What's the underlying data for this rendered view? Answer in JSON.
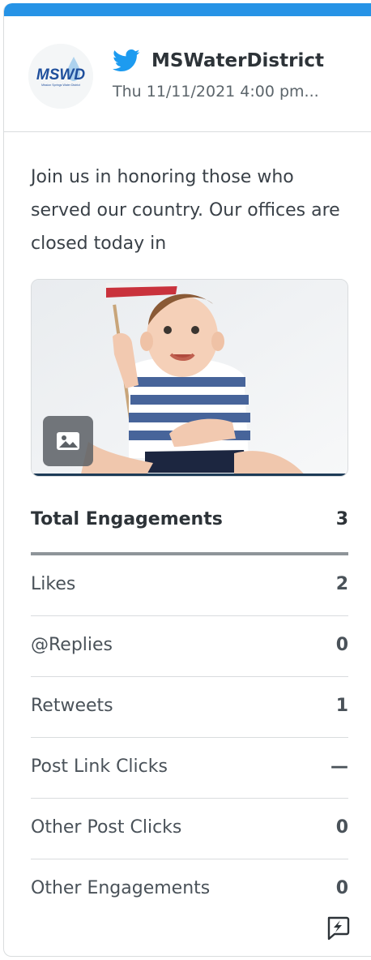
{
  "post": {
    "account_handle": "MSWaterDistrict",
    "date": "Thu 11/11/2021 4:00 pm...",
    "text": "Join us in honoring those who served our country. Our offices are closed today in",
    "logo_text": "MSWD",
    "logo_subtext": "Mission Springs Water District"
  },
  "metrics": {
    "total": {
      "label": "Total Engagements",
      "value": "3"
    },
    "rows": [
      {
        "label": "Likes",
        "value": "2"
      },
      {
        "label": "@Replies",
        "value": "0"
      },
      {
        "label": "Retweets",
        "value": "1"
      },
      {
        "label": "Post Link Clicks",
        "value": "—"
      },
      {
        "label": "Other Post Clicks",
        "value": "0"
      },
      {
        "label": "Other Engagements",
        "value": "0"
      }
    ]
  },
  "icons": {
    "network": "twitter-icon",
    "media_type": "image-icon",
    "action": "boost-icon"
  },
  "colors": {
    "accent_bar": "#2693e6",
    "twitter_blue": "#1d9bf0"
  }
}
